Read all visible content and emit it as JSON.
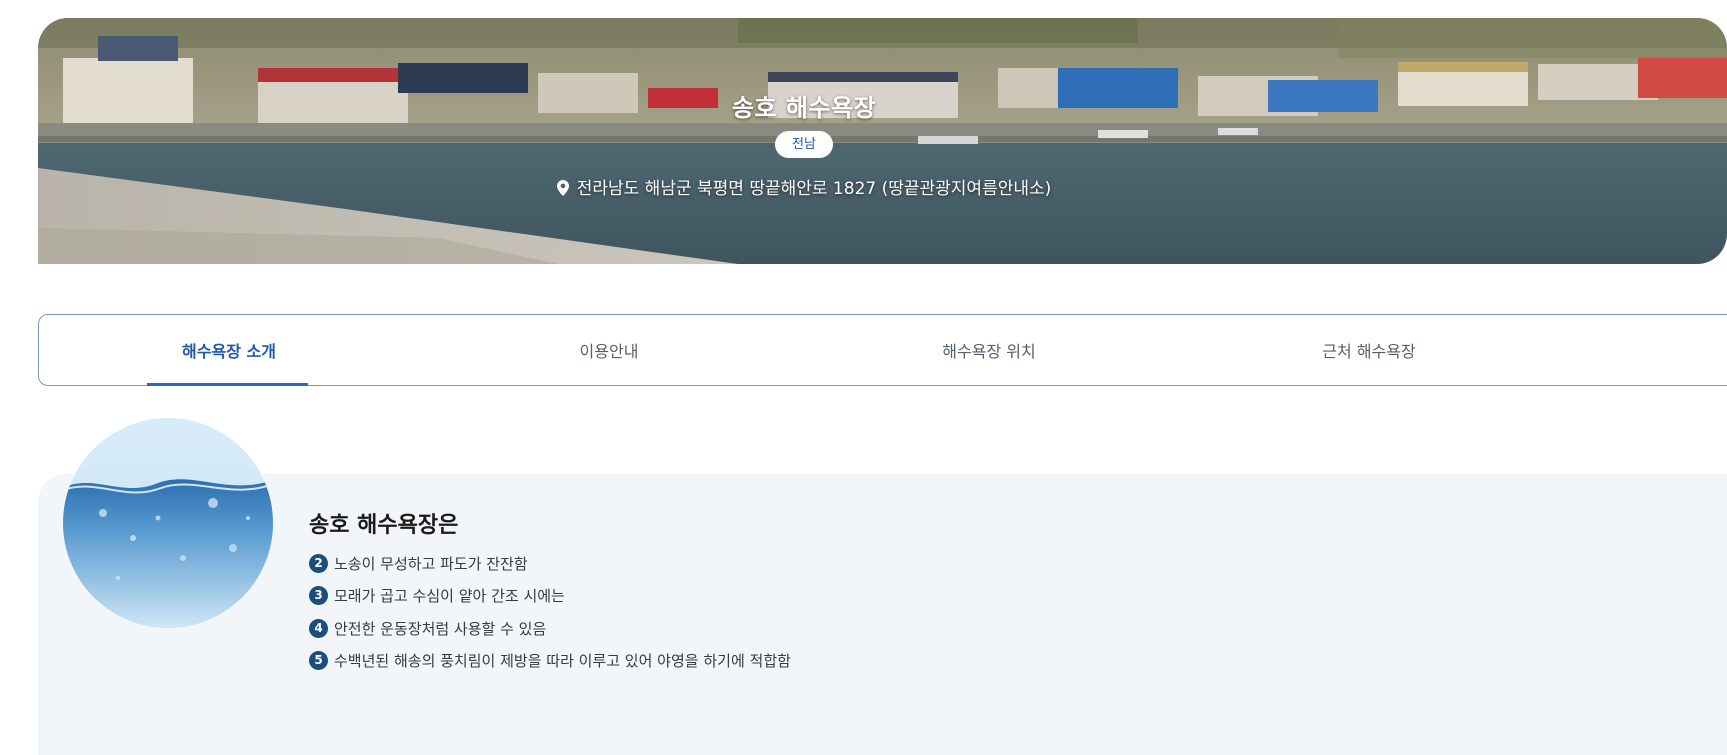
{
  "hero": {
    "title": "송호 해수욕장",
    "region_badge": "전남",
    "address": "전라남도 해남군 북평면 땅끝해안로 1827 (땅끝관광지여름안내소)",
    "pin_icon": "map-pin-icon"
  },
  "tabs": [
    {
      "label": "해수욕장 소개",
      "active": true
    },
    {
      "label": "이용안내",
      "active": false
    },
    {
      "label": "해수욕장 위치",
      "active": false
    },
    {
      "label": "근처 해수욕장",
      "active": false
    }
  ],
  "intro": {
    "title": "송호 해수욕장은",
    "items": [
      {
        "num": "2",
        "text": "노송이 무성하고 파도가 잔잔함"
      },
      {
        "num": "3",
        "text": "모래가 곱고 수심이 얕아 간조 시에는"
      },
      {
        "num": "4",
        "text": "안전한 운동장처럼 사용할 수 있음"
      },
      {
        "num": "5",
        "text": "수백년된 해송의 풍치림이 제방을 따라 이루고 있어 야영을 하기에 적합함"
      }
    ]
  },
  "colors": {
    "accent": "#1f5aa8",
    "tab_underline": "#2f66c3",
    "badge_bg": "#1d4d7d",
    "panel_bg": "#f3f6f9"
  }
}
